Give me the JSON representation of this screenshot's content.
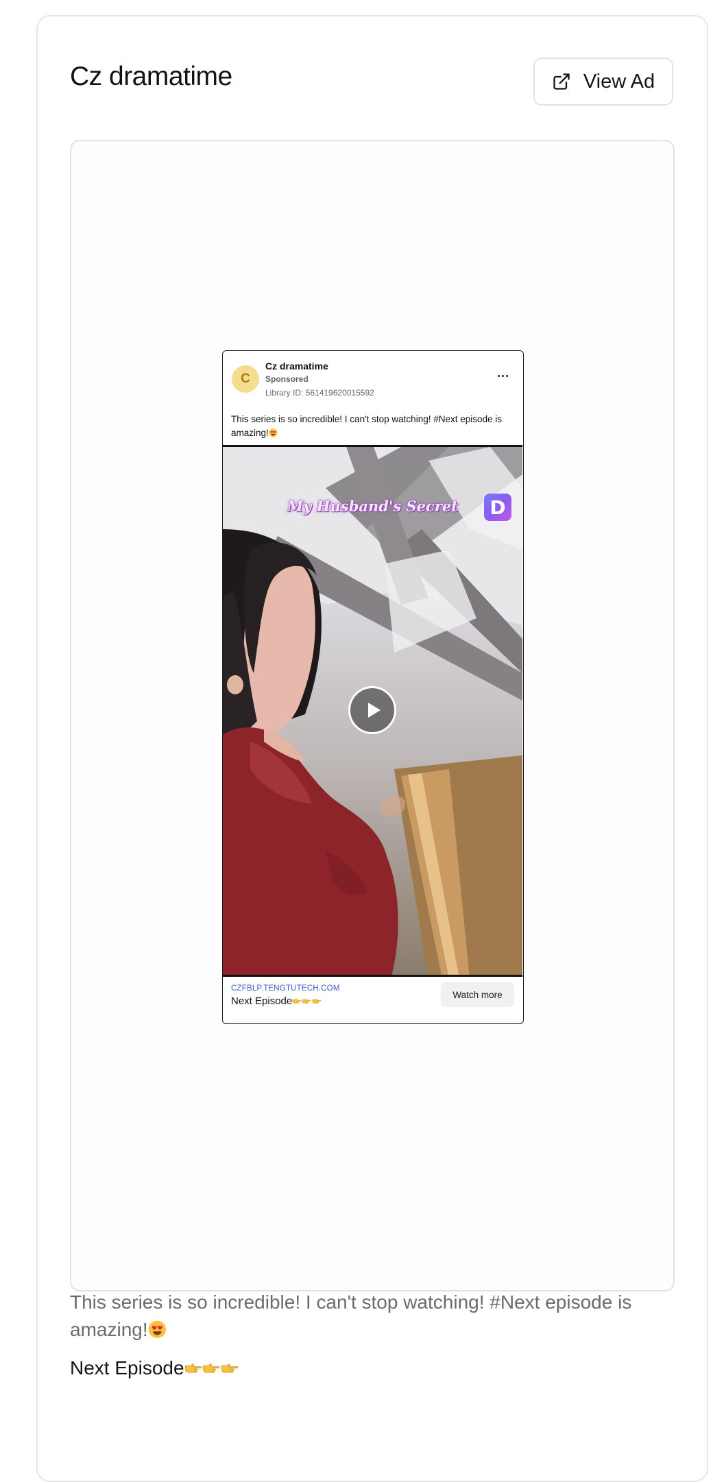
{
  "header": {
    "title": "Cz dramatime",
    "view_ad_label": "View Ad",
    "view_ad_icon": "external-link-icon"
  },
  "ad": {
    "avatar_letter": "C",
    "advertiser": "Cz dramatime",
    "sponsored": "Sponsored",
    "library_id": "Library ID: 561419620015592",
    "more_icon": "more-horizontal-icon",
    "body_text": "This series is so incredible! I can't stop watching! #Next episode is amazing!",
    "media": {
      "overlay_title": "My Husband's Secret",
      "brand_logo_letter": "D",
      "play_icon": "play-icon"
    },
    "footer": {
      "domain": "CZFBLP.TENGTUTECH.COM",
      "headline": "Next Episode",
      "cta": "Watch more"
    }
  },
  "caption": {
    "body_text": "This series is so incredible! I can't stop watching! #Next episode is amazing!",
    "headline": "Next Episode"
  },
  "colors": {
    "avatar_bg": "#f6dc8e",
    "domain_link": "#3a5ec7",
    "caption_gray": "#6b6b6b"
  }
}
